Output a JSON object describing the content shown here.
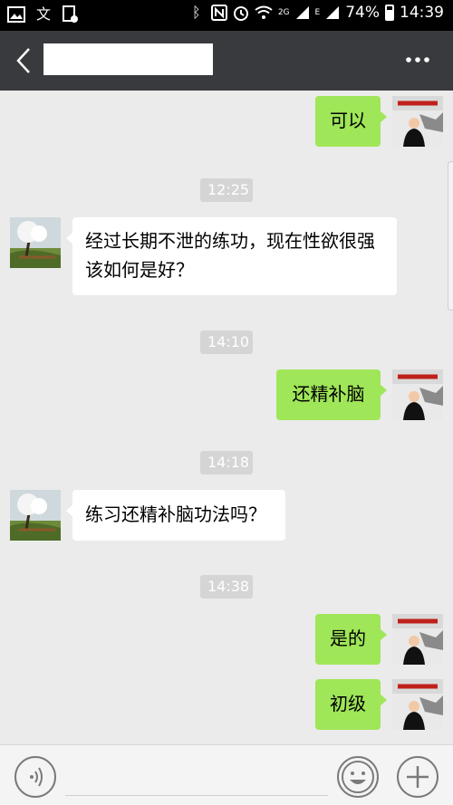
{
  "status_bar": {
    "battery": "74%",
    "time": "14:39",
    "network": "2G",
    "signal_label": "E"
  },
  "header": {
    "title": ""
  },
  "messages": [
    {
      "type": "out",
      "text": "可以"
    },
    {
      "type": "time",
      "text": "12:25"
    },
    {
      "type": "in",
      "lines": [
        "经过长期不泄的练功，现在性欲很强",
        "该如何是好？"
      ]
    },
    {
      "type": "time",
      "text": "14:10"
    },
    {
      "type": "out",
      "text": "还精补脑"
    },
    {
      "type": "time",
      "text": "14:18"
    },
    {
      "type": "in",
      "text": "练习还精补脑功法吗？"
    },
    {
      "type": "time",
      "text": "14:38"
    },
    {
      "type": "out",
      "text": "是的"
    },
    {
      "type": "out",
      "text": "初级"
    }
  ],
  "colors": {
    "outgoing_bubble": "#9fe658",
    "incoming_bubble": "#ffffff",
    "header_bg": "#393a3e",
    "chat_bg": "#ebebeb"
  }
}
